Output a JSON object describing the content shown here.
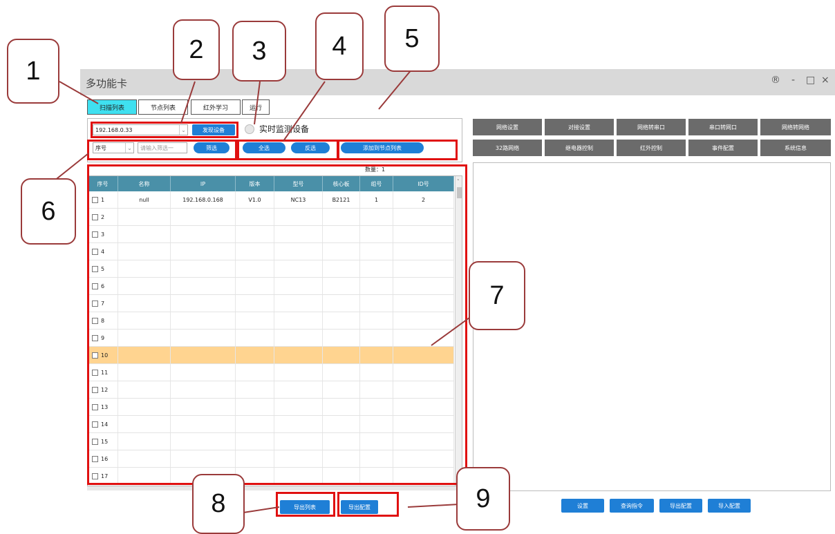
{
  "window": {
    "title": "多功能卡",
    "controls": [
      "®",
      "-",
      "□",
      "×"
    ]
  },
  "tabs": [
    {
      "label": "扫描列表",
      "active": true
    },
    {
      "label": "节点列表",
      "active": false
    },
    {
      "label": "红外学习",
      "active": false
    },
    {
      "label": "运行",
      "active": false
    }
  ],
  "scan": {
    "ip_value": "192.168.0.33",
    "discover_button": "发现设备",
    "monitor_label": "实时监测设备",
    "filter_field": "序号",
    "filter_placeholder": "请输入筛选一",
    "filter_button": "筛选",
    "select_all_button": "全选",
    "invert_button": "反选",
    "add_to_nodes_button": "添加到节点列表",
    "count_label": "数量：1"
  },
  "table": {
    "columns": [
      "序号",
      "名称",
      "IP",
      "版本",
      "型号",
      "核心板",
      "组号",
      "ID号"
    ],
    "rows": [
      [
        "1",
        "null",
        "192.168.0.168",
        "V1.0",
        "NC13",
        "B2121",
        "1",
        "2"
      ],
      [
        "2",
        "",
        "",
        "",
        "",
        "",
        "",
        ""
      ],
      [
        "3",
        "",
        "",
        "",
        "",
        "",
        "",
        ""
      ],
      [
        "4",
        "",
        "",
        "",
        "",
        "",
        "",
        ""
      ],
      [
        "5",
        "",
        "",
        "",
        "",
        "",
        "",
        ""
      ],
      [
        "6",
        "",
        "",
        "",
        "",
        "",
        "",
        ""
      ],
      [
        "7",
        "",
        "",
        "",
        "",
        "",
        "",
        ""
      ],
      [
        "8",
        "",
        "",
        "",
        "",
        "",
        "",
        ""
      ],
      [
        "9",
        "",
        "",
        "",
        "",
        "",
        "",
        ""
      ],
      [
        "10",
        "",
        "",
        "",
        "",
        "",
        "",
        ""
      ],
      [
        "11",
        "",
        "",
        "",
        "",
        "",
        "",
        ""
      ],
      [
        "12",
        "",
        "",
        "",
        "",
        "",
        "",
        ""
      ],
      [
        "13",
        "",
        "",
        "",
        "",
        "",
        "",
        ""
      ],
      [
        "14",
        "",
        "",
        "",
        "",
        "",
        "",
        ""
      ],
      [
        "15",
        "",
        "",
        "",
        "",
        "",
        "",
        ""
      ],
      [
        "16",
        "",
        "",
        "",
        "",
        "",
        "",
        ""
      ],
      [
        "17",
        "",
        "",
        "",
        "",
        "",
        "",
        ""
      ]
    ],
    "highlighted_row": "10"
  },
  "bottom_left": {
    "export_list_button": "导出列表",
    "export_config_button": "导出配置"
  },
  "right": {
    "row1": [
      "网络设置",
      "对接设置",
      "网络转串口",
      "串口转网口",
      "网络转网络"
    ],
    "row2": [
      "32路网络",
      "继电器控制",
      "红外控制",
      "事件配置",
      "系统信息"
    ],
    "bottom_buttons": [
      "设置",
      "查询指令",
      "导出配置",
      "导入配置"
    ]
  },
  "callouts": [
    "1",
    "2",
    "3",
    "4",
    "5",
    "6",
    "7",
    "8",
    "9"
  ],
  "colors": {
    "accent_blue": "#1f7fd6",
    "tab_active": "#3fe0f0",
    "header_teal": "#4a90a8",
    "highlight": "#ffd490",
    "annotation_red": "#e01010"
  }
}
